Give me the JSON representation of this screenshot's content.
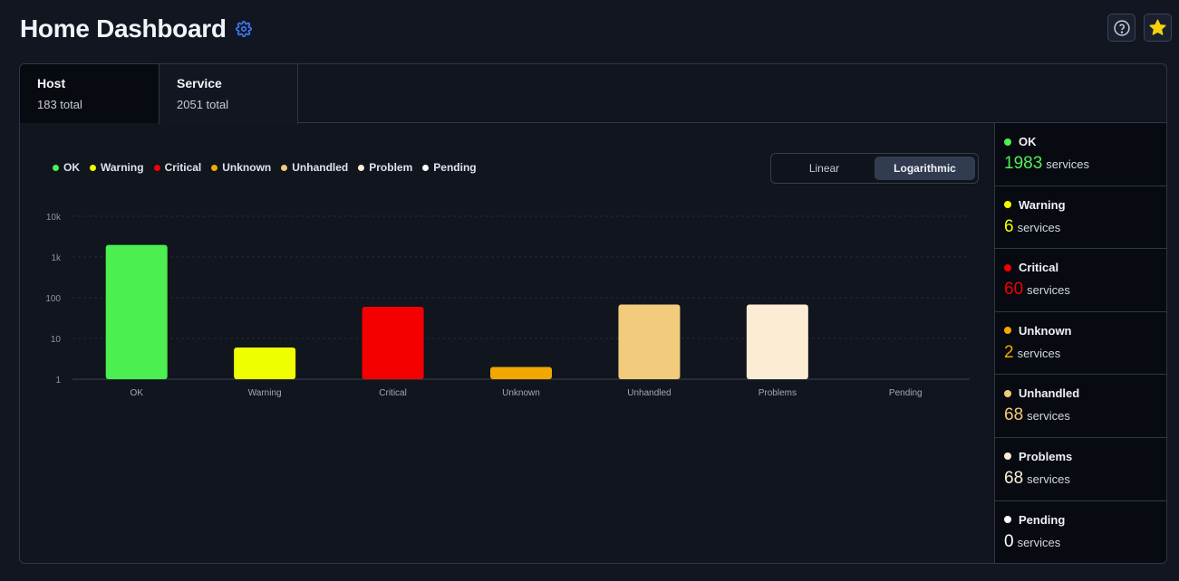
{
  "header": {
    "title": "Home Dashboard",
    "settings_icon": "gear-icon",
    "help_icon": "help-icon",
    "favorite_icon": "star-icon",
    "favorite_color": "#f5d20a"
  },
  "tabs": [
    {
      "label": "Host",
      "sub": "183 total",
      "active": false
    },
    {
      "label": "Service",
      "sub": "2051 total",
      "active": true
    }
  ],
  "legend": [
    {
      "label": "OK",
      "color": "#4ef053"
    },
    {
      "label": "Warning",
      "color": "#f0ff00"
    },
    {
      "label": "Critical",
      "color": "#f40000"
    },
    {
      "label": "Unknown",
      "color": "#f2a900"
    },
    {
      "label": "Unhandled",
      "color": "#f3c97a"
    },
    {
      "label": "Problem",
      "color": "#fceed6"
    },
    {
      "label": "Pending",
      "color": "#ffffff"
    }
  ],
  "scale_toggle": {
    "options": [
      "Linear",
      "Logarithmic"
    ],
    "selected": "Logarithmic"
  },
  "chart_data": {
    "type": "bar",
    "scale": "log",
    "categories": [
      "OK",
      "Warning",
      "Critical",
      "Unknown",
      "Unhandled",
      "Problems",
      "Pending"
    ],
    "values": [
      1983,
      6,
      60,
      2,
      68,
      68,
      0
    ],
    "colors": [
      "#4bef50",
      "#f0ff00",
      "#f40000",
      "#f0a800",
      "#f2cc7c",
      "#fcecd4",
      "#ffffff"
    ],
    "ylim": [
      1,
      10000
    ],
    "ytick_values": [
      1,
      10,
      100,
      1000,
      10000
    ],
    "ytick_labels": [
      "1",
      "10",
      "100",
      "1k",
      "10k"
    ],
    "grid": true,
    "legend": "top-left"
  },
  "summary": [
    {
      "label": "OK",
      "value": "1983",
      "unit": "services",
      "color": "#4ef053"
    },
    {
      "label": "Warning",
      "value": "6",
      "unit": "services",
      "color": "#f0ff00"
    },
    {
      "label": "Critical",
      "value": "60",
      "unit": "services",
      "color": "#f40000"
    },
    {
      "label": "Unknown",
      "value": "2",
      "unit": "services",
      "color": "#f2a900"
    },
    {
      "label": "Unhandled",
      "value": "68",
      "unit": "services",
      "color": "#f3c97a"
    },
    {
      "label": "Problems",
      "value": "68",
      "unit": "services",
      "color": "#fceed6"
    },
    {
      "label": "Pending",
      "value": "0",
      "unit": "services",
      "color": "#ffffff"
    }
  ]
}
